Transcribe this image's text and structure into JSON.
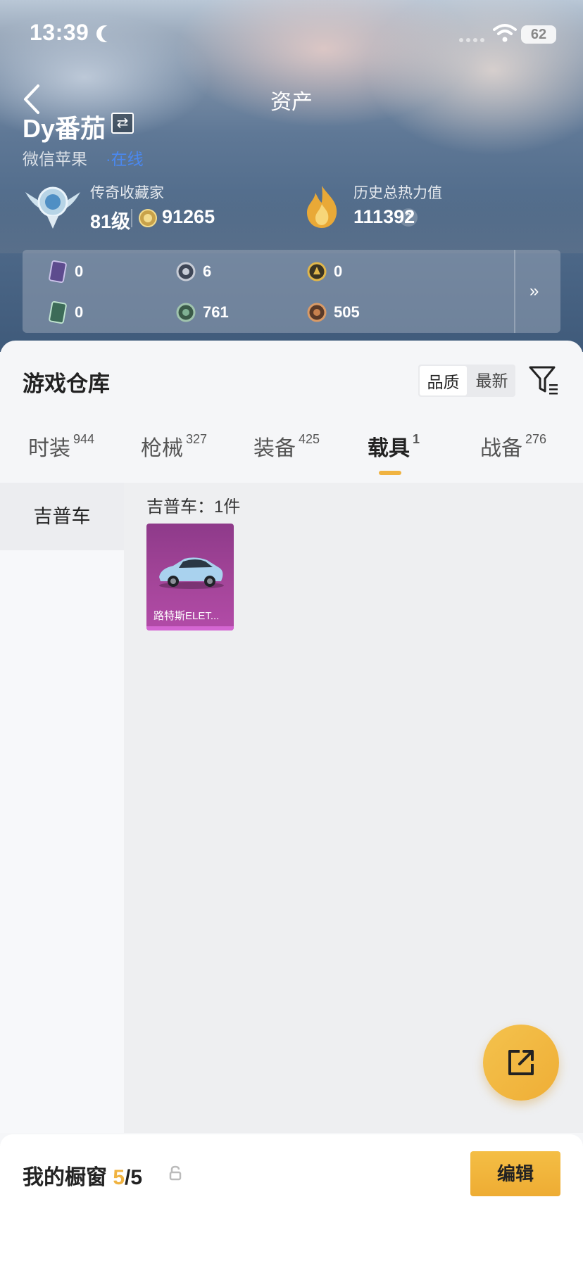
{
  "status_bar": {
    "time": "13:39",
    "battery": "62"
  },
  "header": {
    "title": "资产"
  },
  "profile": {
    "username": "Dy番茄",
    "platform": "微信苹果",
    "online_status": "·在线",
    "rank_title": "传奇收藏家",
    "level": "81级",
    "coins": "91265",
    "heat_label": "历史总热力值",
    "heat_value": "111392",
    "help_mark": "?"
  },
  "resources": [
    {
      "icon": "card-purple-icon",
      "value": "0"
    },
    {
      "icon": "medal-silver-icon",
      "value": "6"
    },
    {
      "icon": "emblem-gold-icon",
      "value": "0"
    },
    {
      "icon": "card-green-icon",
      "value": "0"
    },
    {
      "icon": "orb-green-icon",
      "value": "761"
    },
    {
      "icon": "orb-bronze-icon",
      "value": "505"
    }
  ],
  "more_label": "»",
  "warehouse": {
    "title": "游戏仓库",
    "sort_options": [
      "品质",
      "最新"
    ],
    "active_sort": "品质",
    "tabs": [
      {
        "label": "时装",
        "count": "944"
      },
      {
        "label": "枪械",
        "count": "327"
      },
      {
        "label": "装备",
        "count": "425"
      },
      {
        "label": "载具",
        "count": "1"
      },
      {
        "label": "战备",
        "count": "276"
      }
    ],
    "active_tab": "载具",
    "side_nav": [
      "吉普车"
    ],
    "group_title": "吉普车：1件",
    "items": [
      {
        "name": "路特斯ELET...",
        "rarity_color": "#a44599"
      }
    ]
  },
  "showcase": {
    "label": "我的橱窗",
    "current": "5",
    "total": "/5",
    "edit_label": "编辑"
  },
  "colors": {
    "accent": "#f0b341",
    "online": "#4a88f0",
    "legendary": "#a44599"
  }
}
